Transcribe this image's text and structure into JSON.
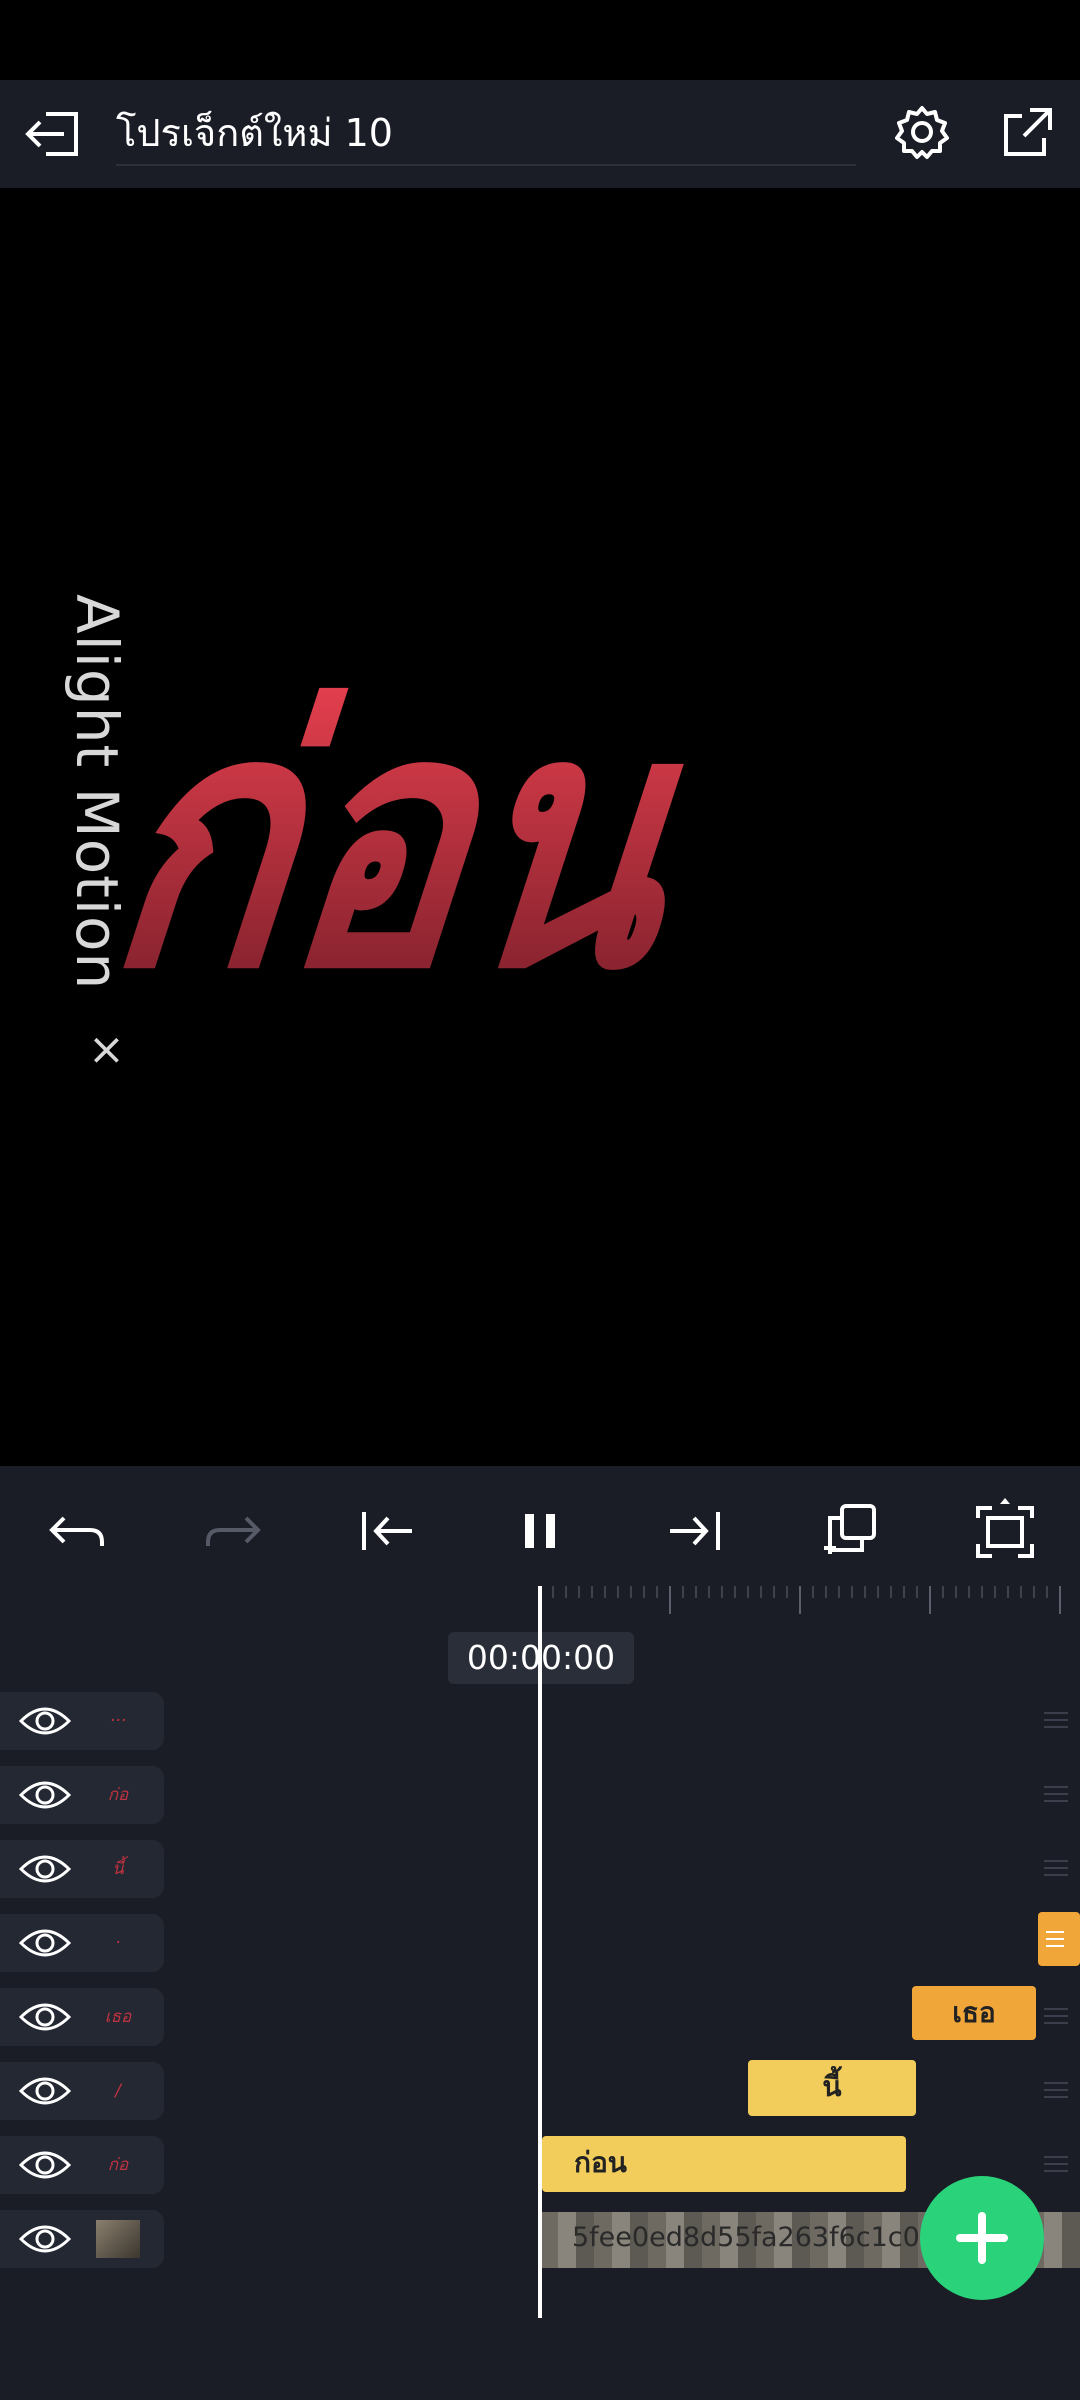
{
  "header": {
    "title": "โปรเจ็กต์ใหม่ 10",
    "back_icon": "exit-icon",
    "settings_icon": "gear-icon",
    "export_icon": "share-export-icon"
  },
  "preview": {
    "watermark": "Alight Motion",
    "watermark_close": "×",
    "big_word": "ก่อน",
    "big_word_color": "#d8394a"
  },
  "toolbar": {
    "icons": [
      "undo-icon",
      "redo-icon",
      "skip-to-start-icon",
      "pause-icon",
      "skip-to-end-icon",
      "duplicate-icon",
      "fullscreen-icon"
    ]
  },
  "timeline": {
    "timecode": "00:00:00",
    "clips": {
      "c1": "เธอ",
      "c2": "นี้",
      "c3": "ก่อน",
      "video_name": "5fee0ed8d55fa263f6c1c0("
    },
    "layers": [
      {
        "thumb": "···"
      },
      {
        "thumb": "ก่อ"
      },
      {
        "thumb": "นี้"
      },
      {
        "thumb": "·"
      },
      {
        "thumb": "เธอ"
      },
      {
        "thumb": "/"
      },
      {
        "thumb": "ก่อ"
      },
      {
        "thumb": "img"
      }
    ],
    "colors": {
      "clip_yellow": "#f2cd5c",
      "clip_orange": "#f1a63a",
      "accent_green": "#2ad27a"
    }
  }
}
